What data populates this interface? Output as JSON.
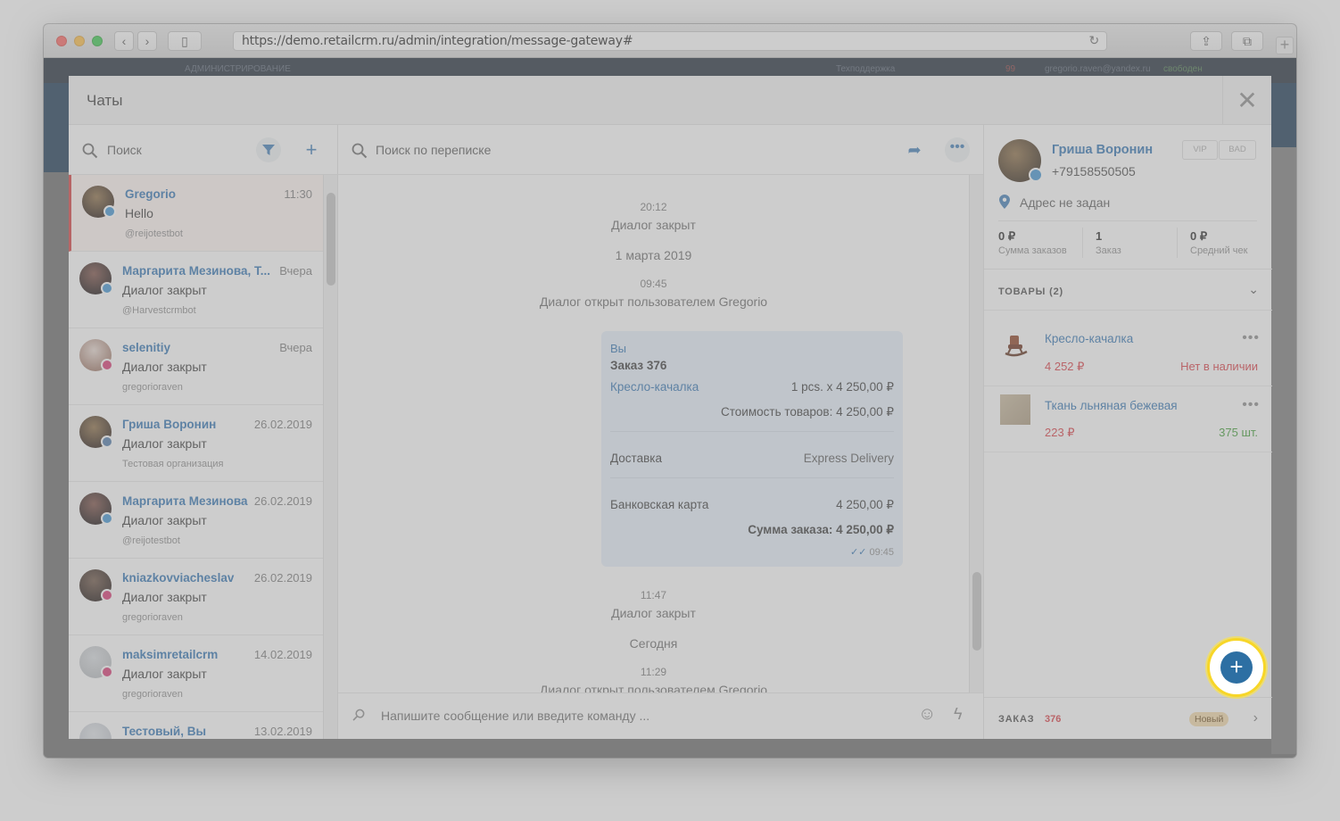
{
  "browser": {
    "url": "https://demo.retailcrm.ru/admin/integration/message-gateway#"
  },
  "bg": {
    "admin": "АДМИНИСТРИРОВАНИЕ",
    "support": "Техподдержка",
    "count": "99",
    "email": "gregorio.raven@yandex.ru",
    "status": "свободен"
  },
  "modal": {
    "title": "Чаты"
  },
  "left": {
    "search_placeholder": "Поиск"
  },
  "chats": [
    {
      "name": "Gregorio",
      "time": "11:30",
      "msg": "Hello",
      "sub": "@reijotestbot",
      "channel": "telegram"
    },
    {
      "name": "Маргарита Мезинова, Т...",
      "time": "Вчера",
      "msg": "Диалог закрыт",
      "sub": "@Harvestcrmbot",
      "channel": "telegram"
    },
    {
      "name": "selenitiy",
      "time": "Вчера",
      "msg": "Диалог закрыт",
      "sub": "gregorioraven",
      "channel": "instagram"
    },
    {
      "name": "Гриша Воронин",
      "time": "26.02.2019",
      "msg": "Диалог закрыт",
      "sub": "Тестовая организация",
      "channel": "vk"
    },
    {
      "name": "Маргарита Мезинова",
      "time": "26.02.2019",
      "msg": "Диалог закрыт",
      "sub": "@reijotestbot",
      "channel": "telegram"
    },
    {
      "name": "kniazkovviacheslav",
      "time": "26.02.2019",
      "msg": "Диалог закрыт",
      "sub": "gregorioraven",
      "channel": "instagram"
    },
    {
      "name": "maksimretailcrm",
      "time": "14.02.2019",
      "msg": "Диалог закрыт",
      "sub": "gregorioraven",
      "channel": "instagram"
    },
    {
      "name": "Тестовый, Вы",
      "time": "13.02.2019",
      "msg": "",
      "sub": "",
      "channel": ""
    }
  ],
  "mid": {
    "search_placeholder": "Поиск по переписке",
    "composer_placeholder": "Напишите сообщение или введите команду ...",
    "events": [
      {
        "time": "20:12",
        "text": "Диалог закрыт"
      },
      {
        "date": "1 марта 2019"
      },
      {
        "time": "09:45",
        "text": "Диалог открыт пользователем Gregorio"
      },
      {
        "time": "11:47",
        "text": "Диалог закрыт"
      },
      {
        "date": "Сегодня"
      },
      {
        "time": "11:29",
        "text": "Диалог открыт пользователем Gregorio"
      }
    ],
    "order_msg": {
      "author": "Вы",
      "title": "Заказ 376",
      "item_name": "Кресло-качалка",
      "item_qty": "1 pcs. x 4 250,00 ₽",
      "goods_total": "Стоимость товаров: 4 250,00 ₽",
      "delivery_label": "Доставка",
      "delivery_value": "Express Delivery",
      "payment_label": "Банковская карта",
      "payment_value": "4 250,00 ₽",
      "order_total": "Сумма заказа: 4 250,00 ₽",
      "time": "09:45"
    }
  },
  "right": {
    "name": "Гриша Воронин",
    "phone": "+79158550505",
    "tags": [
      "VIP",
      "BAD"
    ],
    "address": "Адрес не задан",
    "stats": [
      {
        "value": "0 ₽",
        "label": "Сумма заказов"
      },
      {
        "value": "1",
        "label": "Заказ"
      },
      {
        "value": "0 ₽",
        "label": "Средний чек"
      }
    ],
    "products_title": "ТОВАРЫ (2)",
    "products": [
      {
        "name": "Кресло-качалка",
        "price": "4 252 ₽",
        "stock": "Нет в наличии",
        "stock_color": "#d9363e"
      },
      {
        "name": "Ткань льняная бежевая",
        "price": "223 ₽",
        "stock": "375 шт.",
        "stock_color": "#3a9a2f"
      }
    ],
    "order": {
      "label": "ЗАКАЗ",
      "number": "376",
      "status": "Новый"
    }
  }
}
